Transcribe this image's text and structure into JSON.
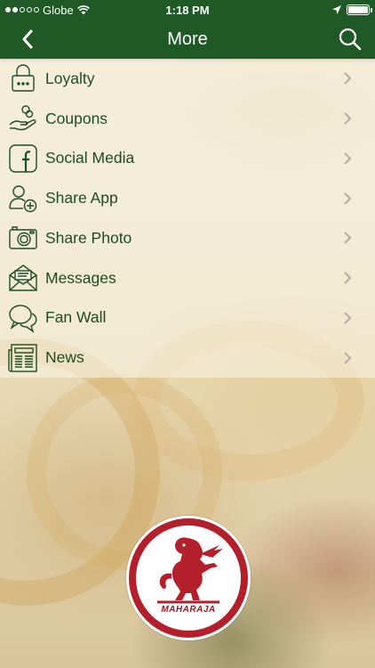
{
  "status_bar": {
    "carrier": "Globe",
    "time": "1:18 PM",
    "battery_level": 1.0
  },
  "nav": {
    "title": "More",
    "back_icon": "chevron-left-icon",
    "search_icon": "search-icon"
  },
  "menu": {
    "items": [
      {
        "label": "Loyalty",
        "icon": "padlock-icon"
      },
      {
        "label": "Coupons",
        "icon": "hand-coins-icon"
      },
      {
        "label": "Social Media",
        "icon": "facebook-icon"
      },
      {
        "label": "Share App",
        "icon": "person-add-icon"
      },
      {
        "label": "Share Photo",
        "icon": "camera-icon"
      },
      {
        "label": "Messages",
        "icon": "envelope-icon"
      },
      {
        "label": "Fan Wall",
        "icon": "speech-bubbles-icon"
      },
      {
        "label": "News",
        "icon": "newspaper-icon"
      }
    ]
  },
  "logo": {
    "text": "MAHARAJA"
  },
  "colors": {
    "brand_green": "#1f5a26",
    "text_green": "#1e4d22",
    "logo_red": "#b3202b"
  }
}
